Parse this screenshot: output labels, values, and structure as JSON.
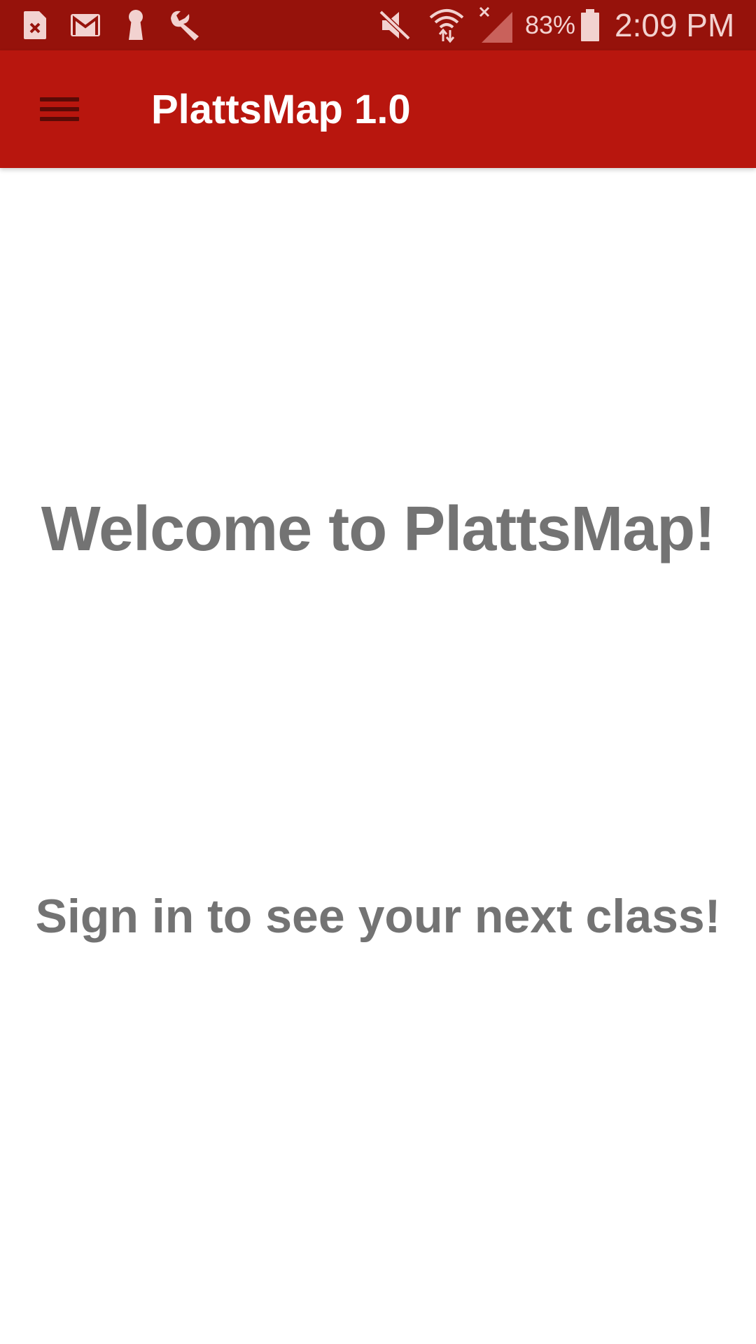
{
  "status_bar": {
    "battery_percent": "83%",
    "time": "2:09 PM",
    "icons": [
      "sim-error-icon",
      "gmail-icon",
      "keyhole-icon",
      "wrench-icon",
      "mute-icon",
      "wifi-icon",
      "no-signal-icon",
      "battery-icon"
    ]
  },
  "app_bar": {
    "title": "PlattsMap 1.0",
    "menu_icon": "hamburger-menu-icon",
    "background": "#b8160e"
  },
  "main": {
    "welcome_text": "Welcome to PlattsMap!",
    "signin_text": "Sign in to see your next class!"
  },
  "colors": {
    "status_bar": "#96120b",
    "accent": "#b8160e",
    "text_gray": "#737373"
  }
}
